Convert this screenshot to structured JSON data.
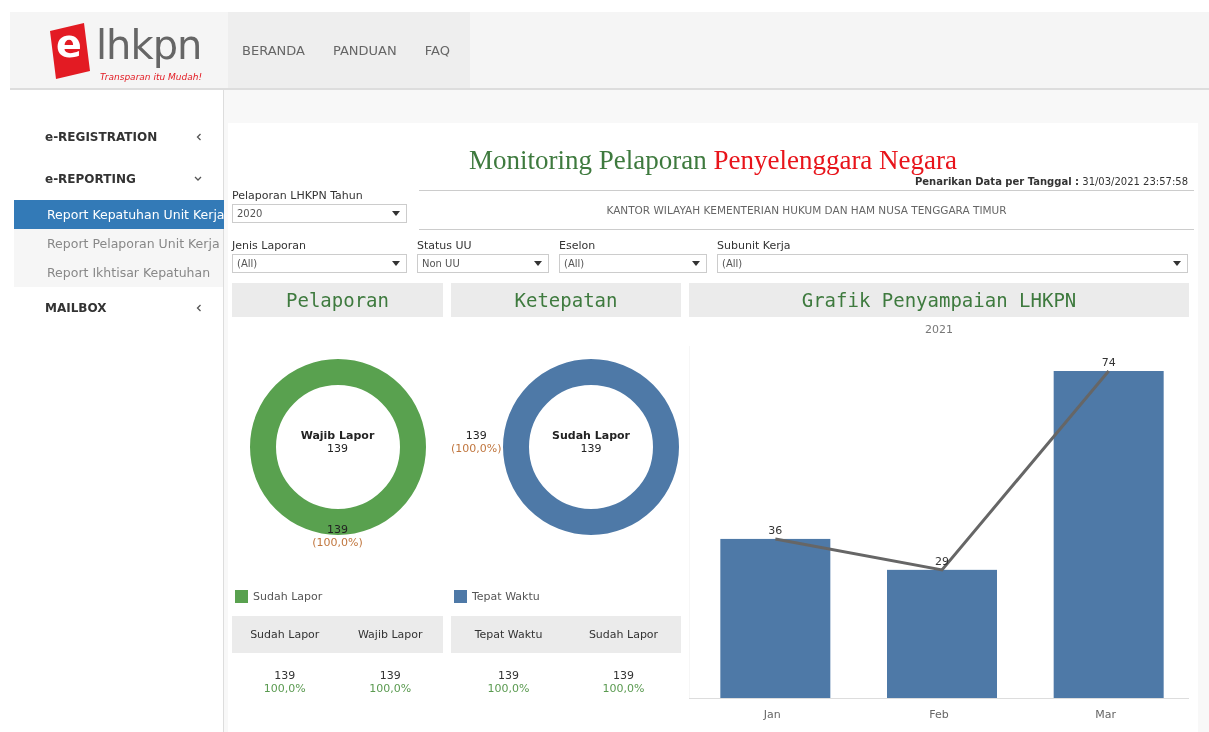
{
  "logo": {
    "letter": "e",
    "name": "lhkpn",
    "tagline": "Transparan itu Mudah!"
  },
  "nav": [
    "BERANDA",
    "PANDUAN",
    "FAQ"
  ],
  "sidebar": {
    "items": [
      {
        "label": "e-REGISTRATION",
        "expanded": false
      },
      {
        "label": "e-REPORTING",
        "expanded": true,
        "children": [
          {
            "label": "Report Kepatuhan Unit Kerja",
            "selected": true
          },
          {
            "label": "Report Pelaporan Unit Kerja",
            "selected": false
          },
          {
            "label": "Report Ikhtisar Kepatuhan",
            "selected": false
          }
        ]
      },
      {
        "label": "MAILBOX",
        "expanded": false
      }
    ]
  },
  "title": {
    "part_1": "Monitoring Pelaporan",
    "part_2": "Penyelenggara Negara"
  },
  "data_date": {
    "label": "Penarikan Data per Tanggal :",
    "value": "31/03/2021 23:57:58"
  },
  "year_filter": {
    "label": "Pelaporan LHKPN Tahun",
    "value": "2020"
  },
  "office": "KANTOR WILAYAH KEMENTERIAN HUKUM DAN HAM NUSA TENGGARA TIMUR",
  "filters": [
    {
      "label": "Jenis Laporan",
      "value": "(All)"
    },
    {
      "label": "Status UU",
      "value": "Non UU"
    },
    {
      "label": "Eselon",
      "value": "(All)"
    },
    {
      "label": "Subunit Kerja",
      "value": "(All)"
    }
  ],
  "panels": [
    {
      "title": "Pelaporan",
      "center_label": "Wajib Lapor",
      "center_value": "139",
      "ring_value": "139",
      "ring_percent": "(100,0%)",
      "kind": "bottom",
      "legend": {
        "label": "Sudah Lapor",
        "color": "#59a14f"
      },
      "table": {
        "columns": [
          "Sudah Lapor",
          "Wajib Lapor"
        ],
        "rows": [
          [
            "139",
            "139"
          ],
          [
            "100,0%",
            "100,0%"
          ]
        ]
      }
    },
    {
      "title": "Ketepatan",
      "center_label": "Sudah Lapor",
      "center_value": "139",
      "ring_value": "139",
      "ring_percent": "(100,0%)",
      "kind": "side",
      "legend": {
        "label": "Tepat Waktu",
        "color": "#4e79a7"
      },
      "table": {
        "columns": [
          "Tepat Waktu",
          "Sudah Lapor"
        ],
        "rows": [
          [
            "139",
            "139"
          ],
          [
            "100,0%",
            "100,0%"
          ]
        ]
      }
    }
  ],
  "chart_panel": {
    "title": "Grafik Penyampaian LHKPN",
    "chart_data": {
      "type": "bar",
      "title": "2021",
      "categories": [
        "Jan",
        "Feb",
        "Mar"
      ],
      "values": [
        36,
        29,
        74
      ],
      "data_labels": true
    }
  }
}
